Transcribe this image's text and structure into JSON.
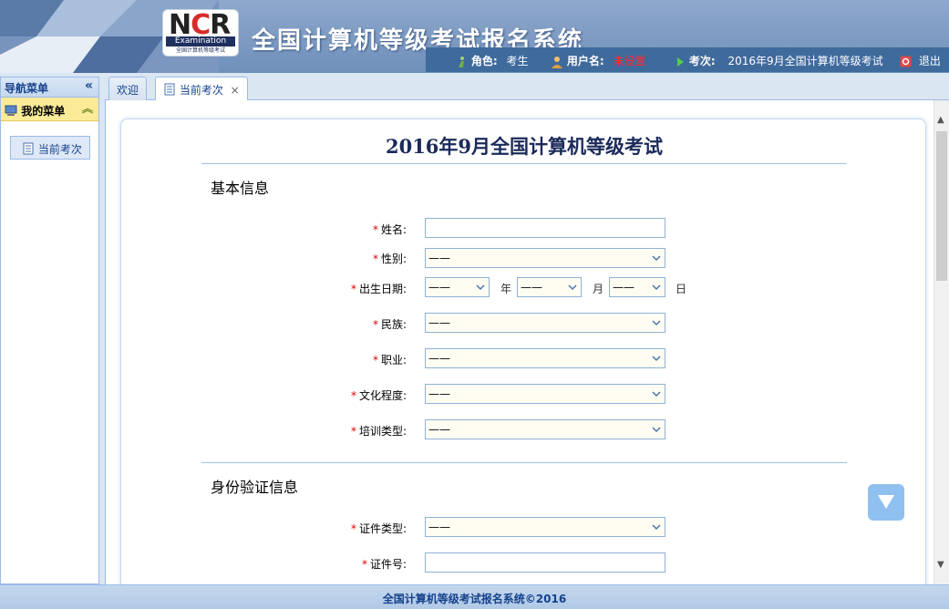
{
  "header": {
    "logo_main": "NCR",
    "logo_sub": "Examination",
    "logo_caption": "全国计算机等级考试",
    "title": "全国计算机等级考试报名系统",
    "role_label": "角色:",
    "role_value": "考生",
    "user_label": "用户名:",
    "user_value": "未设置",
    "session_label": "考次:",
    "session_value": "2016年9月全国计算机等级考试",
    "logout": "退出"
  },
  "nav": {
    "title": "导航菜单",
    "menu_title": "我的菜单",
    "items": [
      {
        "label": "当前考次"
      }
    ]
  },
  "tabs": [
    {
      "label": "欢迎"
    },
    {
      "label": "当前考次",
      "close": "×"
    }
  ],
  "form": {
    "title": "2016年9月全国计算机等级考试",
    "section_basic": "基本信息",
    "section_id": "身份验证信息",
    "required_mark": "*",
    "name_label": "姓名:",
    "name_value": "",
    "gender_label": "性别:",
    "gender_value": "——",
    "birth_label": "出生日期:",
    "birth_year": "——",
    "birth_month": "——",
    "birth_day": "——",
    "year_unit": "年",
    "month_unit": "月",
    "day_unit": "日",
    "ethnicity_label": "民族:",
    "ethnicity_value": "——",
    "occupation_label": "职业:",
    "occupation_value": "——",
    "education_label": "文化程度:",
    "education_value": "——",
    "training_label": "培训类型:",
    "training_value": "——",
    "idtype_label": "证件类型:",
    "idtype_value": "——",
    "idnum_label": "证件号:",
    "idnum_value": ""
  },
  "footer": "全国计算机等级考试报名系统©2016",
  "colors": {
    "header_bg": "#6f8fba",
    "infobar_bg": "#3f6a9c",
    "nav_border": "#99bbe8",
    "menu_bg": "#fbeb99",
    "required": "#dd0000",
    "title_text": "#1b2a5a"
  }
}
